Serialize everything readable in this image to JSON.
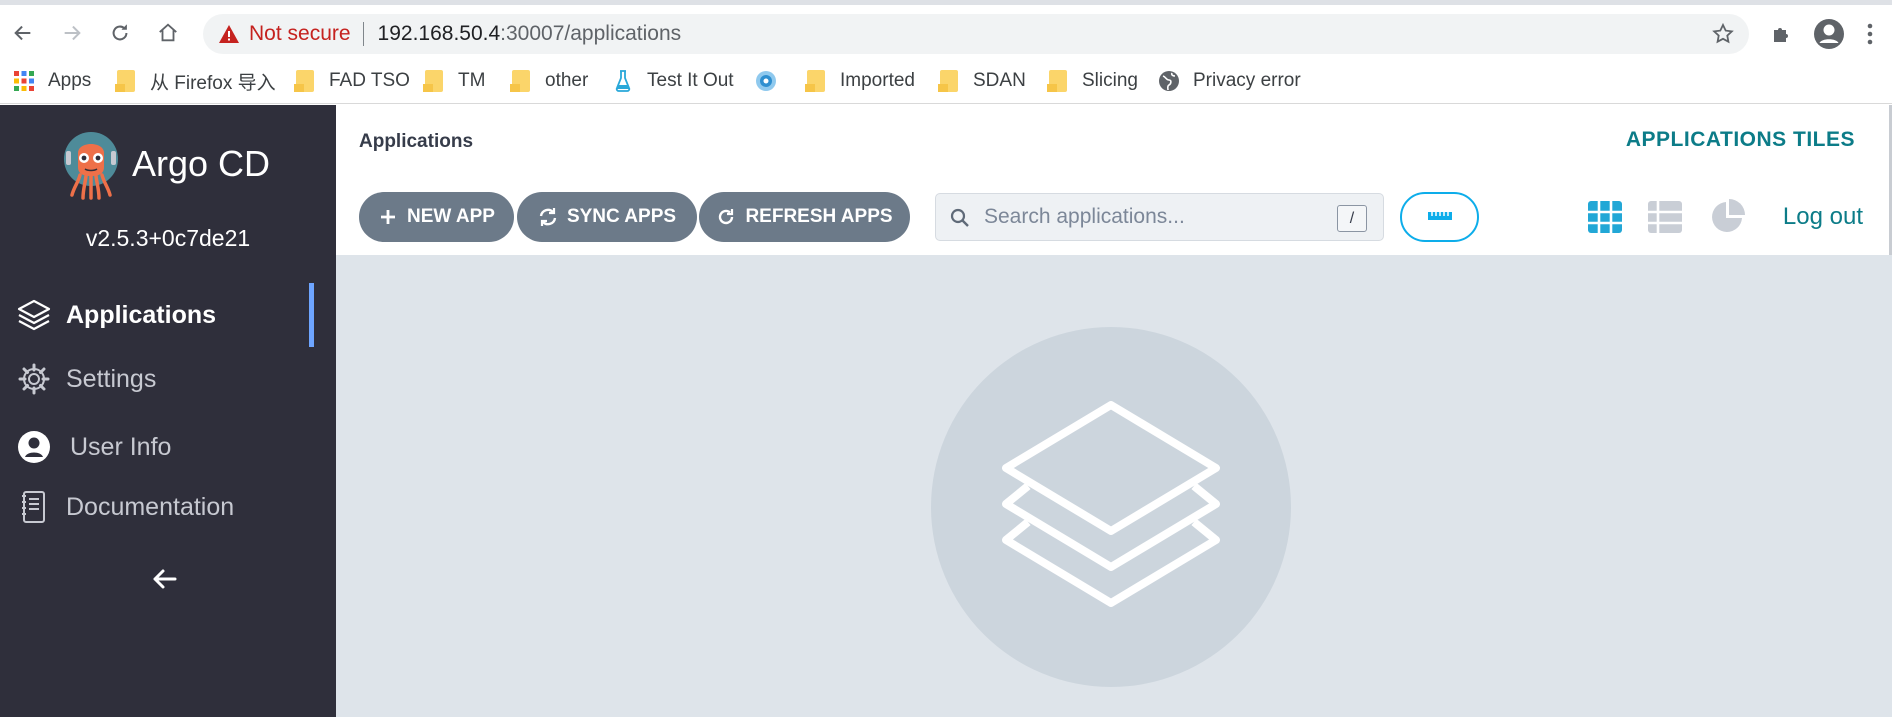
{
  "browser": {
    "security_label": "Not secure",
    "url_host": "192.168.50.4",
    "url_path": ":30007/applications",
    "bookmarks": [
      {
        "label": "Apps",
        "icon": "apps-grid-icon"
      },
      {
        "label": "从 Firefox 导入",
        "icon": "folder-icon"
      },
      {
        "label": "FAD TSO",
        "icon": "folder-icon"
      },
      {
        "label": "TM",
        "icon": "folder-icon"
      },
      {
        "label": "other",
        "icon": "folder-icon"
      },
      {
        "label": "Test It Out",
        "icon": "flask-icon"
      },
      {
        "label": "",
        "icon": "disc-icon"
      },
      {
        "label": "Imported",
        "icon": "folder-icon"
      },
      {
        "label": "SDAN",
        "icon": "folder-icon"
      },
      {
        "label": "Slicing",
        "icon": "folder-icon"
      },
      {
        "label": "Privacy error",
        "icon": "globe-icon"
      }
    ]
  },
  "sidebar": {
    "brand": "Argo CD",
    "version": "v2.5.3+0c7de21",
    "items": [
      {
        "label": "Applications",
        "icon": "layers-icon",
        "active": true
      },
      {
        "label": "Settings",
        "icon": "gear-icon",
        "active": false
      },
      {
        "label": "User Info",
        "icon": "user-icon",
        "active": false
      },
      {
        "label": "Documentation",
        "icon": "book-icon",
        "active": false
      }
    ]
  },
  "main": {
    "title": "Applications",
    "view_title": "APPLICATIONS TILES",
    "buttons": {
      "new_app": "NEW APP",
      "sync_apps": "SYNC APPS",
      "refresh_apps": "REFRESH APPS"
    },
    "search": {
      "placeholder": "Search applications...",
      "shortcut": "/"
    },
    "logout": "Log out"
  },
  "colors": {
    "sidebar_bg": "#2f2f3b",
    "accent_teal": "#0c7c88",
    "button_gray": "#6c7a89",
    "active_blue": "#6ea5ff",
    "tiles_icon": "#22a7d6"
  }
}
